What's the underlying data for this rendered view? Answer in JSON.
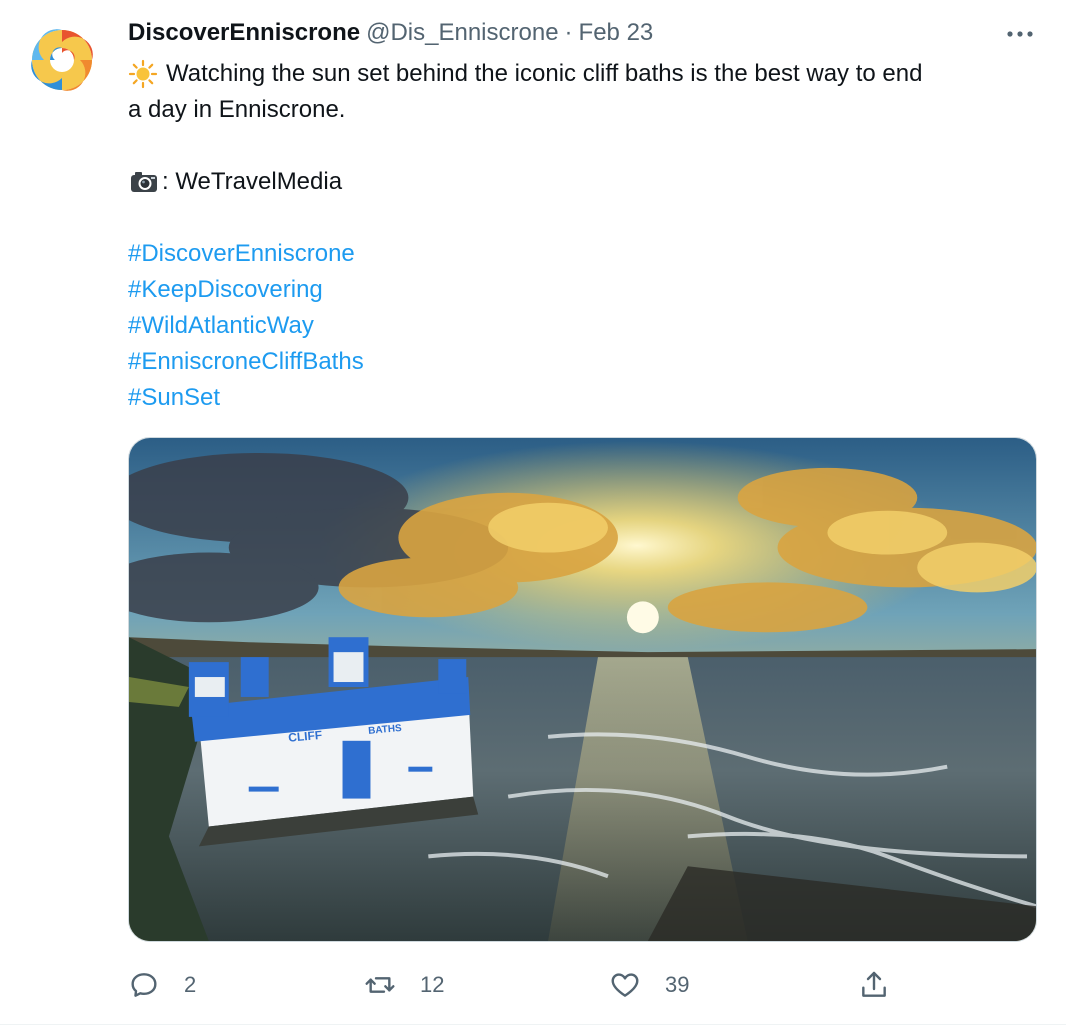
{
  "author": {
    "display_name": "DiscoverEnniscrone",
    "handle": "@Dis_Enniscrone",
    "separator": "·",
    "date": "Feb 23",
    "avatar_icon": "swirl-logo-icon"
  },
  "tweet": {
    "line1": "Watching the sun set behind the iconic cliff baths is the best way to end",
    "line2": "a day in Enniscrone.",
    "credit": ": WeTravelMedia",
    "hashtags": [
      "#DiscoverEnniscrone",
      "#KeepDiscovering",
      "#WildAtlanticWay",
      "#EnniscroneCliffBaths",
      "#SunSet"
    ],
    "emoji_icons": [
      "sun-icon",
      "camera-icon"
    ]
  },
  "media": {
    "sign_left": "CLIFF",
    "sign_right": "BATHS"
  },
  "actions": {
    "reply_count": "2",
    "retweet_count": "12",
    "like_count": "39"
  },
  "colors": {
    "link": "#1d9bf0",
    "secondary_text": "#536471",
    "primary_text": "#0f1419"
  }
}
